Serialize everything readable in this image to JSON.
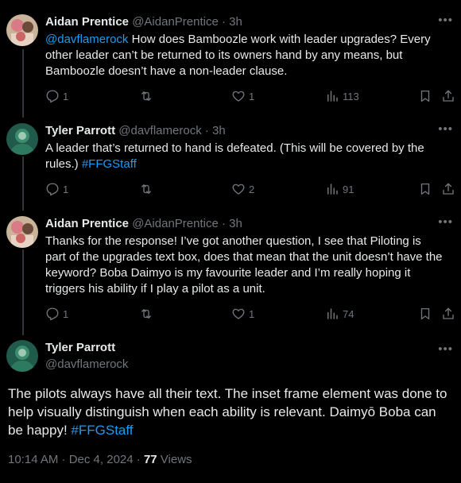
{
  "replies": [
    {
      "name": "Aidan Prentice",
      "handle": "@AidanPrentice",
      "dot": "·",
      "time": "3h",
      "mention": "@davflamerock",
      "text": " How does Bamboozle work with leader upgrades? Every other leader can’t be returned to its owners hand by any means, but Bamboozle doesn’t have a non-leader clause.",
      "replies": "1",
      "retweets": "",
      "likes": "1",
      "views": "113"
    },
    {
      "name": "Tyler Parrott",
      "handle": "@davflamerock",
      "dot": "·",
      "time": "3h",
      "text": "A leader that’s returned to hand is defeated. (This will be covered by the rules.) ",
      "hashtag": "#FFGStaff",
      "replies": "1",
      "retweets": "",
      "likes": "2",
      "views": "91"
    },
    {
      "name": "Aidan Prentice",
      "handle": "@AidanPrentice",
      "dot": "·",
      "time": "3h",
      "text": "Thanks for the response! I’ve got another question, I see that Piloting is part of the upgrades text box, does that mean that the unit doesn’t have the keyword? Boba Daimyo is my favourite leader and I’m really hoping it triggers his ability if I play a pilot as a unit.",
      "replies": "1",
      "retweets": "",
      "likes": "1",
      "views": "74"
    }
  ],
  "main": {
    "name": "Tyler Parrott",
    "handle": "@davflamerock",
    "text": "The pilots always have all their text. The inset frame element was done to help visually distinguish when each ability is relevant. Daimyō Boba can be happy! ",
    "hashtag": "#FFGStaff",
    "timestamp": "10:14 AM · Dec 4, 2024 · ",
    "views_count": "77",
    "views_label": " Views"
  },
  "icons": {
    "reply": "reply-icon",
    "retweet": "retweet-icon",
    "like": "heart-icon",
    "views": "views-icon",
    "bookmark": "bookmark-icon",
    "share": "share-icon",
    "more": "more-icon"
  },
  "colors": {
    "background": "#000000",
    "text": "#e7e9ea",
    "secondary": "#71767b",
    "link": "#1d9bf0",
    "thread_line": "#333639"
  }
}
